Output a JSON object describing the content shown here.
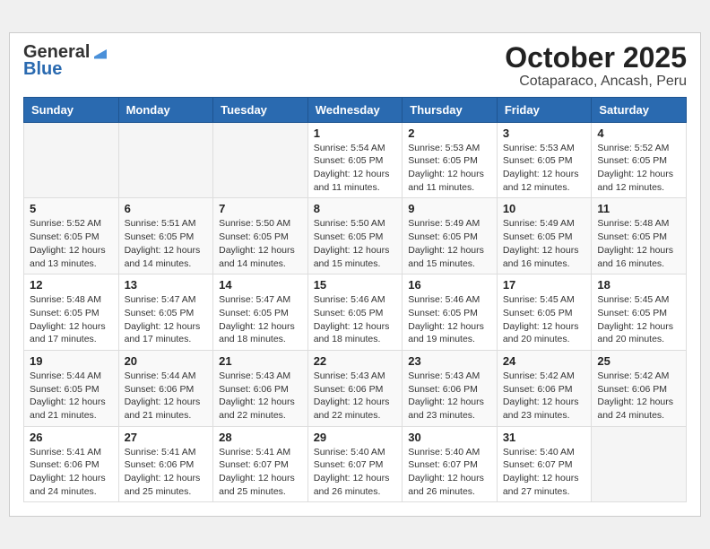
{
  "header": {
    "logo_line1": "General",
    "logo_line2": "Blue",
    "month": "October 2025",
    "location": "Cotaparaco, Ancash, Peru"
  },
  "weekdays": [
    "Sunday",
    "Monday",
    "Tuesday",
    "Wednesday",
    "Thursday",
    "Friday",
    "Saturday"
  ],
  "weeks": [
    [
      {
        "day": "",
        "info": ""
      },
      {
        "day": "",
        "info": ""
      },
      {
        "day": "",
        "info": ""
      },
      {
        "day": "1",
        "info": "Sunrise: 5:54 AM\nSunset: 6:05 PM\nDaylight: 12 hours and 11 minutes."
      },
      {
        "day": "2",
        "info": "Sunrise: 5:53 AM\nSunset: 6:05 PM\nDaylight: 12 hours and 11 minutes."
      },
      {
        "day": "3",
        "info": "Sunrise: 5:53 AM\nSunset: 6:05 PM\nDaylight: 12 hours and 12 minutes."
      },
      {
        "day": "4",
        "info": "Sunrise: 5:52 AM\nSunset: 6:05 PM\nDaylight: 12 hours and 12 minutes."
      }
    ],
    [
      {
        "day": "5",
        "info": "Sunrise: 5:52 AM\nSunset: 6:05 PM\nDaylight: 12 hours and 13 minutes."
      },
      {
        "day": "6",
        "info": "Sunrise: 5:51 AM\nSunset: 6:05 PM\nDaylight: 12 hours and 14 minutes."
      },
      {
        "day": "7",
        "info": "Sunrise: 5:50 AM\nSunset: 6:05 PM\nDaylight: 12 hours and 14 minutes."
      },
      {
        "day": "8",
        "info": "Sunrise: 5:50 AM\nSunset: 6:05 PM\nDaylight: 12 hours and 15 minutes."
      },
      {
        "day": "9",
        "info": "Sunrise: 5:49 AM\nSunset: 6:05 PM\nDaylight: 12 hours and 15 minutes."
      },
      {
        "day": "10",
        "info": "Sunrise: 5:49 AM\nSunset: 6:05 PM\nDaylight: 12 hours and 16 minutes."
      },
      {
        "day": "11",
        "info": "Sunrise: 5:48 AM\nSunset: 6:05 PM\nDaylight: 12 hours and 16 minutes."
      }
    ],
    [
      {
        "day": "12",
        "info": "Sunrise: 5:48 AM\nSunset: 6:05 PM\nDaylight: 12 hours and 17 minutes."
      },
      {
        "day": "13",
        "info": "Sunrise: 5:47 AM\nSunset: 6:05 PM\nDaylight: 12 hours and 17 minutes."
      },
      {
        "day": "14",
        "info": "Sunrise: 5:47 AM\nSunset: 6:05 PM\nDaylight: 12 hours and 18 minutes."
      },
      {
        "day": "15",
        "info": "Sunrise: 5:46 AM\nSunset: 6:05 PM\nDaylight: 12 hours and 18 minutes."
      },
      {
        "day": "16",
        "info": "Sunrise: 5:46 AM\nSunset: 6:05 PM\nDaylight: 12 hours and 19 minutes."
      },
      {
        "day": "17",
        "info": "Sunrise: 5:45 AM\nSunset: 6:05 PM\nDaylight: 12 hours and 20 minutes."
      },
      {
        "day": "18",
        "info": "Sunrise: 5:45 AM\nSunset: 6:05 PM\nDaylight: 12 hours and 20 minutes."
      }
    ],
    [
      {
        "day": "19",
        "info": "Sunrise: 5:44 AM\nSunset: 6:05 PM\nDaylight: 12 hours and 21 minutes."
      },
      {
        "day": "20",
        "info": "Sunrise: 5:44 AM\nSunset: 6:06 PM\nDaylight: 12 hours and 21 minutes."
      },
      {
        "day": "21",
        "info": "Sunrise: 5:43 AM\nSunset: 6:06 PM\nDaylight: 12 hours and 22 minutes."
      },
      {
        "day": "22",
        "info": "Sunrise: 5:43 AM\nSunset: 6:06 PM\nDaylight: 12 hours and 22 minutes."
      },
      {
        "day": "23",
        "info": "Sunrise: 5:43 AM\nSunset: 6:06 PM\nDaylight: 12 hours and 23 minutes."
      },
      {
        "day": "24",
        "info": "Sunrise: 5:42 AM\nSunset: 6:06 PM\nDaylight: 12 hours and 23 minutes."
      },
      {
        "day": "25",
        "info": "Sunrise: 5:42 AM\nSunset: 6:06 PM\nDaylight: 12 hours and 24 minutes."
      }
    ],
    [
      {
        "day": "26",
        "info": "Sunrise: 5:41 AM\nSunset: 6:06 PM\nDaylight: 12 hours and 24 minutes."
      },
      {
        "day": "27",
        "info": "Sunrise: 5:41 AM\nSunset: 6:06 PM\nDaylight: 12 hours and 25 minutes."
      },
      {
        "day": "28",
        "info": "Sunrise: 5:41 AM\nSunset: 6:07 PM\nDaylight: 12 hours and 25 minutes."
      },
      {
        "day": "29",
        "info": "Sunrise: 5:40 AM\nSunset: 6:07 PM\nDaylight: 12 hours and 26 minutes."
      },
      {
        "day": "30",
        "info": "Sunrise: 5:40 AM\nSunset: 6:07 PM\nDaylight: 12 hours and 26 minutes."
      },
      {
        "day": "31",
        "info": "Sunrise: 5:40 AM\nSunset: 6:07 PM\nDaylight: 12 hours and 27 minutes."
      },
      {
        "day": "",
        "info": ""
      }
    ]
  ]
}
